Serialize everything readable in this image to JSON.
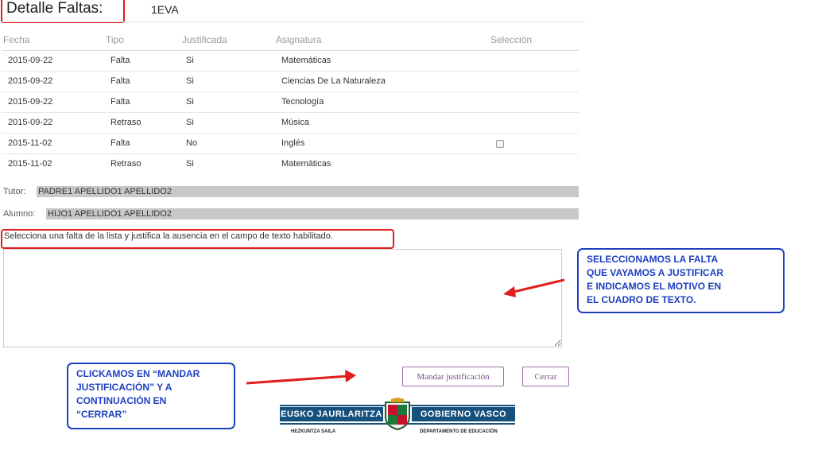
{
  "header": {
    "title": "Detalle Faltas:",
    "evaluation": "1EVA"
  },
  "table": {
    "columns": [
      "Fecha",
      "Tipo",
      "Justificada",
      "Asignatura",
      "Selección"
    ],
    "rows": [
      {
        "fecha": "2015-09-22",
        "tipo": "Falta",
        "justificada": "Si",
        "asignatura": "Matemáticas",
        "checkbox": false
      },
      {
        "fecha": "2015-09-22",
        "tipo": "Falta",
        "justificada": "Si",
        "asignatura": "Ciencias De La Naturaleza",
        "checkbox": false
      },
      {
        "fecha": "2015-09-22",
        "tipo": "Falta",
        "justificada": "Si",
        "asignatura": "Tecnología",
        "checkbox": false
      },
      {
        "fecha": "2015-09-22",
        "tipo": "Retraso",
        "justificada": "Si",
        "asignatura": "Música",
        "checkbox": false
      },
      {
        "fecha": "2015-11-02",
        "tipo": "Falta",
        "justificada": "No",
        "asignatura": "Inglés",
        "checkbox": true
      },
      {
        "fecha": "2015-11-02",
        "tipo": "Retraso",
        "justificada": "Si",
        "asignatura": "Matemáticas",
        "checkbox": false
      }
    ]
  },
  "tutor": {
    "label": "Tutor:",
    "value": "PADRE1 APELLIDO1 APELLIDO2"
  },
  "alumno": {
    "label": "Alumno:",
    "value": "HIJO1 APELLIDO1 APELLIDO2"
  },
  "instruction": "Selecciona una falta de la lista y justifica la ausencia en el campo de texto habilitado.",
  "justification": {
    "value": "",
    "placeholder": ""
  },
  "buttons": {
    "send": "Mandar justificación",
    "close": "Cerrar"
  },
  "callouts": {
    "right": [
      "SELECCIONAMOS LA FALTA",
      "QUE VAYAMOS A JUSTIFICAR",
      "E INDICAMOS EL MOTIVO EN",
      "EL CUADRO DE TEXTO."
    ],
    "left": [
      "CLICKAMOS EN “MANDAR",
      "JUSTIFICACIÓN” Y A",
      "CONTINUACIÓN EN",
      "“CERRAR”"
    ]
  },
  "colors": {
    "highlight_red": "#e01e1e",
    "callout_blue": "#1e3fbf",
    "button_purple": "#9b6fa6",
    "logo_blue": "#16507c"
  },
  "footer_logo": {
    "left_name": "EUSKO JAURLARITZA",
    "right_name": "GOBIERNO VASCO",
    "left_sub": "HEZKUNTZA SAILA",
    "right_sub": "DEPARTAMENTO DE EDUCACIÓN",
    "emblem_icon": "coat-of-arms-icon"
  }
}
